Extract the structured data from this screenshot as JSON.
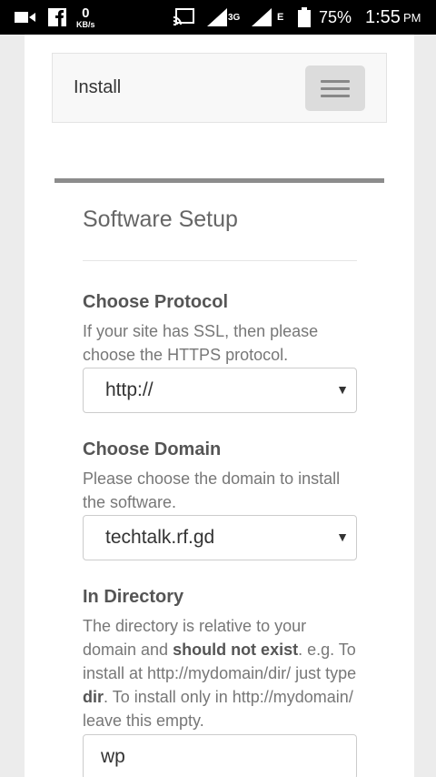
{
  "status_bar": {
    "speed_value": "0",
    "speed_unit": "KB/s",
    "network_3g": "3G",
    "network_e": "E",
    "battery": "75%",
    "time": "1:55",
    "ampm": "PM"
  },
  "navbar": {
    "brand": "Install"
  },
  "setup": {
    "title": "Software Setup",
    "protocol": {
      "label": "Choose Protocol",
      "help": "If your site has SSL, then please choose the HTTPS protocol.",
      "selected": "http://"
    },
    "domain": {
      "label": "Choose Domain",
      "help": "Please choose the domain to install the software.",
      "selected": "techtalk.rf.gd"
    },
    "directory": {
      "label": "In Directory",
      "help_1": "The directory is relative to your domain and ",
      "help_2": "should not exist",
      "help_3": ". e.g. To install at http://mydomain/dir/ just type ",
      "help_4": "dir",
      "help_5": ". To install only in http://mydomain/ leave this empty.",
      "value": "wp"
    }
  }
}
